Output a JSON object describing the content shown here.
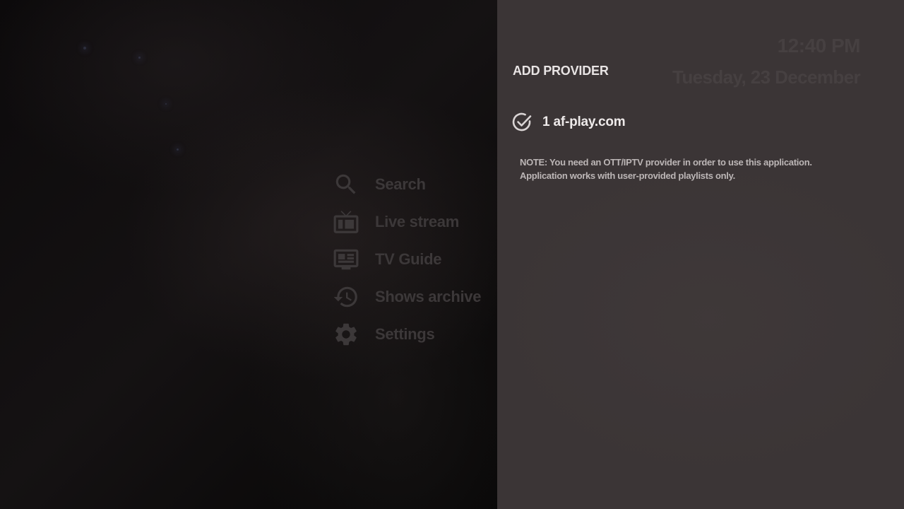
{
  "clock": {
    "time": "12:40 PM",
    "date": "Tuesday, 23 December"
  },
  "menu": {
    "items": [
      {
        "label": "Search",
        "icon": "search-icon"
      },
      {
        "label": "Live stream",
        "icon": "tv-icon"
      },
      {
        "label": "TV Guide",
        "icon": "tv-guide-icon"
      },
      {
        "label": "Shows archive",
        "icon": "history-icon"
      },
      {
        "label": "Settings",
        "icon": "gear-icon"
      }
    ]
  },
  "panel": {
    "title": "ADD PROVIDER",
    "providers": [
      {
        "index": "1",
        "name": "af-play.com",
        "label": "1 af-play.com",
        "icon": "check-circle-icon"
      }
    ],
    "note": {
      "line1": "NOTE: You need an OTT/IPTV provider in order to use this application.",
      "line2": "Application works with user-provided playlists only."
    }
  },
  "colors": {
    "panel_bg": "#3b3536",
    "menu_text_dim": "#3c3839",
    "panel_text": "#eeeaea",
    "note_text": "#bcb6b6",
    "clock_text": "#464041"
  }
}
